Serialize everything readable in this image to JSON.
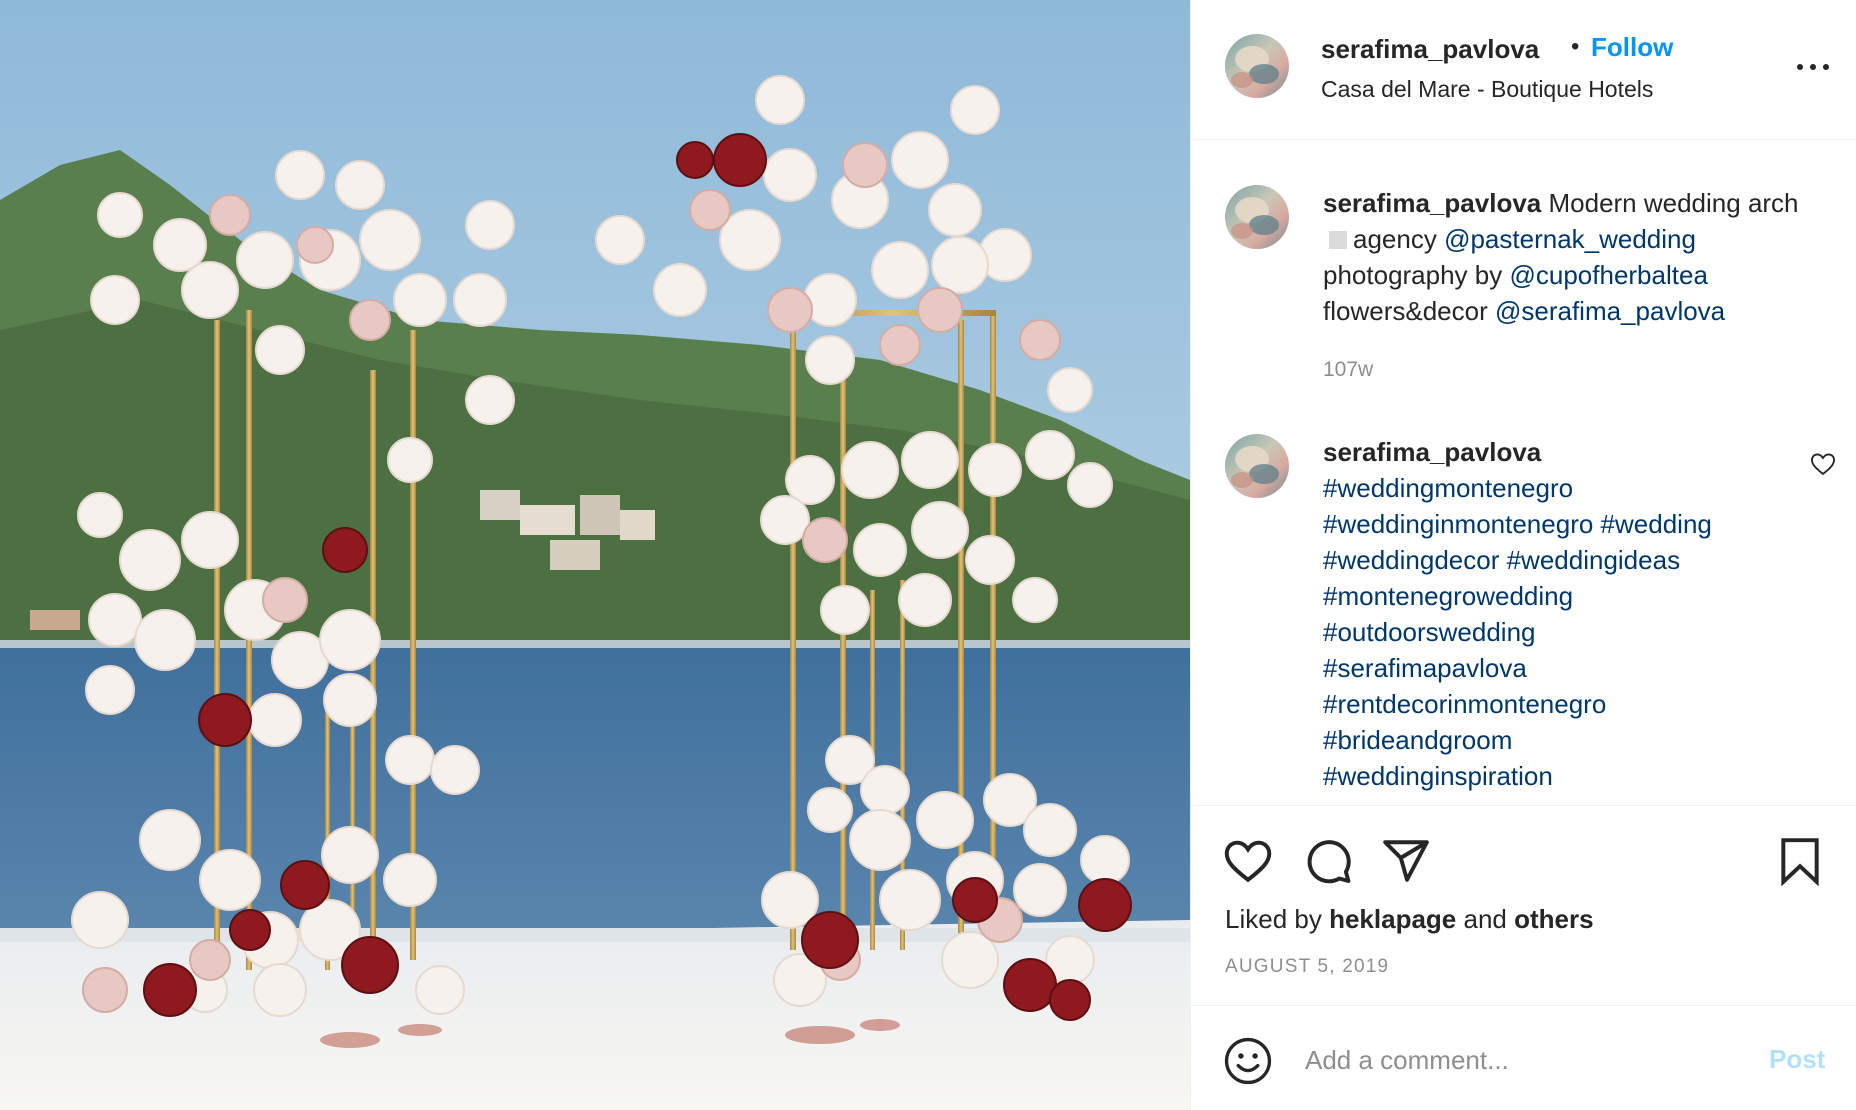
{
  "post": {
    "image_alt": "Modern wedding arch of gold stands with white and red roses by the sea"
  },
  "header": {
    "username": "serafima_pavlova",
    "separator": "•",
    "follow_label": "Follow",
    "location": "Casa del Mare - Boutique Hotels",
    "more_icon": "more-horizontal-icon"
  },
  "caption": {
    "username": "serafima_pavlova",
    "text_1": "Modern wedding arch",
    "text_2": "agency",
    "mention_agency": "@pasternak_wedding",
    "text_3": "photography by",
    "mention_photo": "@cupofherbaltea",
    "text_4": "flowers&decor",
    "mention_decor": "@serafima_pavlova",
    "time": "107w"
  },
  "comment": {
    "username": "serafima_pavlova",
    "hashtags": [
      "#weddingmontenegro",
      "#weddinginmontenegro",
      "#wedding",
      "#weddingdecor",
      "#weddingideas",
      "#montenegrowedding",
      "#outdoorswedding",
      "#serafimapavlova",
      "#rentdecorinmontenegro",
      "#brideandgroom",
      "#weddinginspiration"
    ]
  },
  "actions": {
    "like_icon": "heart-icon",
    "comment_icon": "comment-icon",
    "share_icon": "paper-plane-icon",
    "save_icon": "bookmark-icon",
    "liked_by_prefix": "Liked by",
    "liked_by_user": "heklapage",
    "liked_by_and": "and",
    "liked_by_others": "others",
    "date": "AUGUST 5, 2019"
  },
  "add_comment": {
    "placeholder": "Add a comment...",
    "post_label": "Post",
    "emoji_icon": "smiley-icon"
  },
  "colors": {
    "link": "#00376b",
    "follow": "#0095f6",
    "post_disabled": "#b2dffc",
    "muted": "#8e8e8e"
  }
}
